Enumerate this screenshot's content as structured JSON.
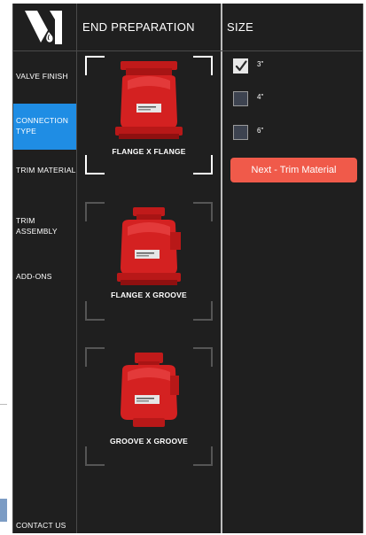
{
  "brand": {
    "logo_icon": "valve-v-logo",
    "accent": "#1f8de4",
    "button_color": "#f05a4a",
    "product_color": "#d42121"
  },
  "sidebar": {
    "items": [
      {
        "label": "VALVE FINISH",
        "active": false
      },
      {
        "label": "CONNECTION TYPE",
        "active": true
      },
      {
        "label": "TRIM MATERIAL",
        "active": false
      },
      {
        "label": "TRIM ASSEMBLY",
        "active": false
      },
      {
        "label": "ADD-ONS",
        "active": false
      }
    ],
    "contact_label": "CONTACT US"
  },
  "end_preparation": {
    "heading": "END PREPARATION",
    "options": [
      {
        "label": "FLANGE X FLANGE",
        "selected": true
      },
      {
        "label": "FLANGE X GROOVE",
        "selected": false
      },
      {
        "label": "GROOVE X GROOVE",
        "selected": false
      }
    ]
  },
  "size": {
    "heading": "SIZE",
    "options": [
      {
        "label": "3\"",
        "checked": true
      },
      {
        "label": "4\"",
        "checked": false
      },
      {
        "label": "6\"",
        "checked": false
      }
    ]
  },
  "actions": {
    "next_label": "Next - Trim Material"
  }
}
